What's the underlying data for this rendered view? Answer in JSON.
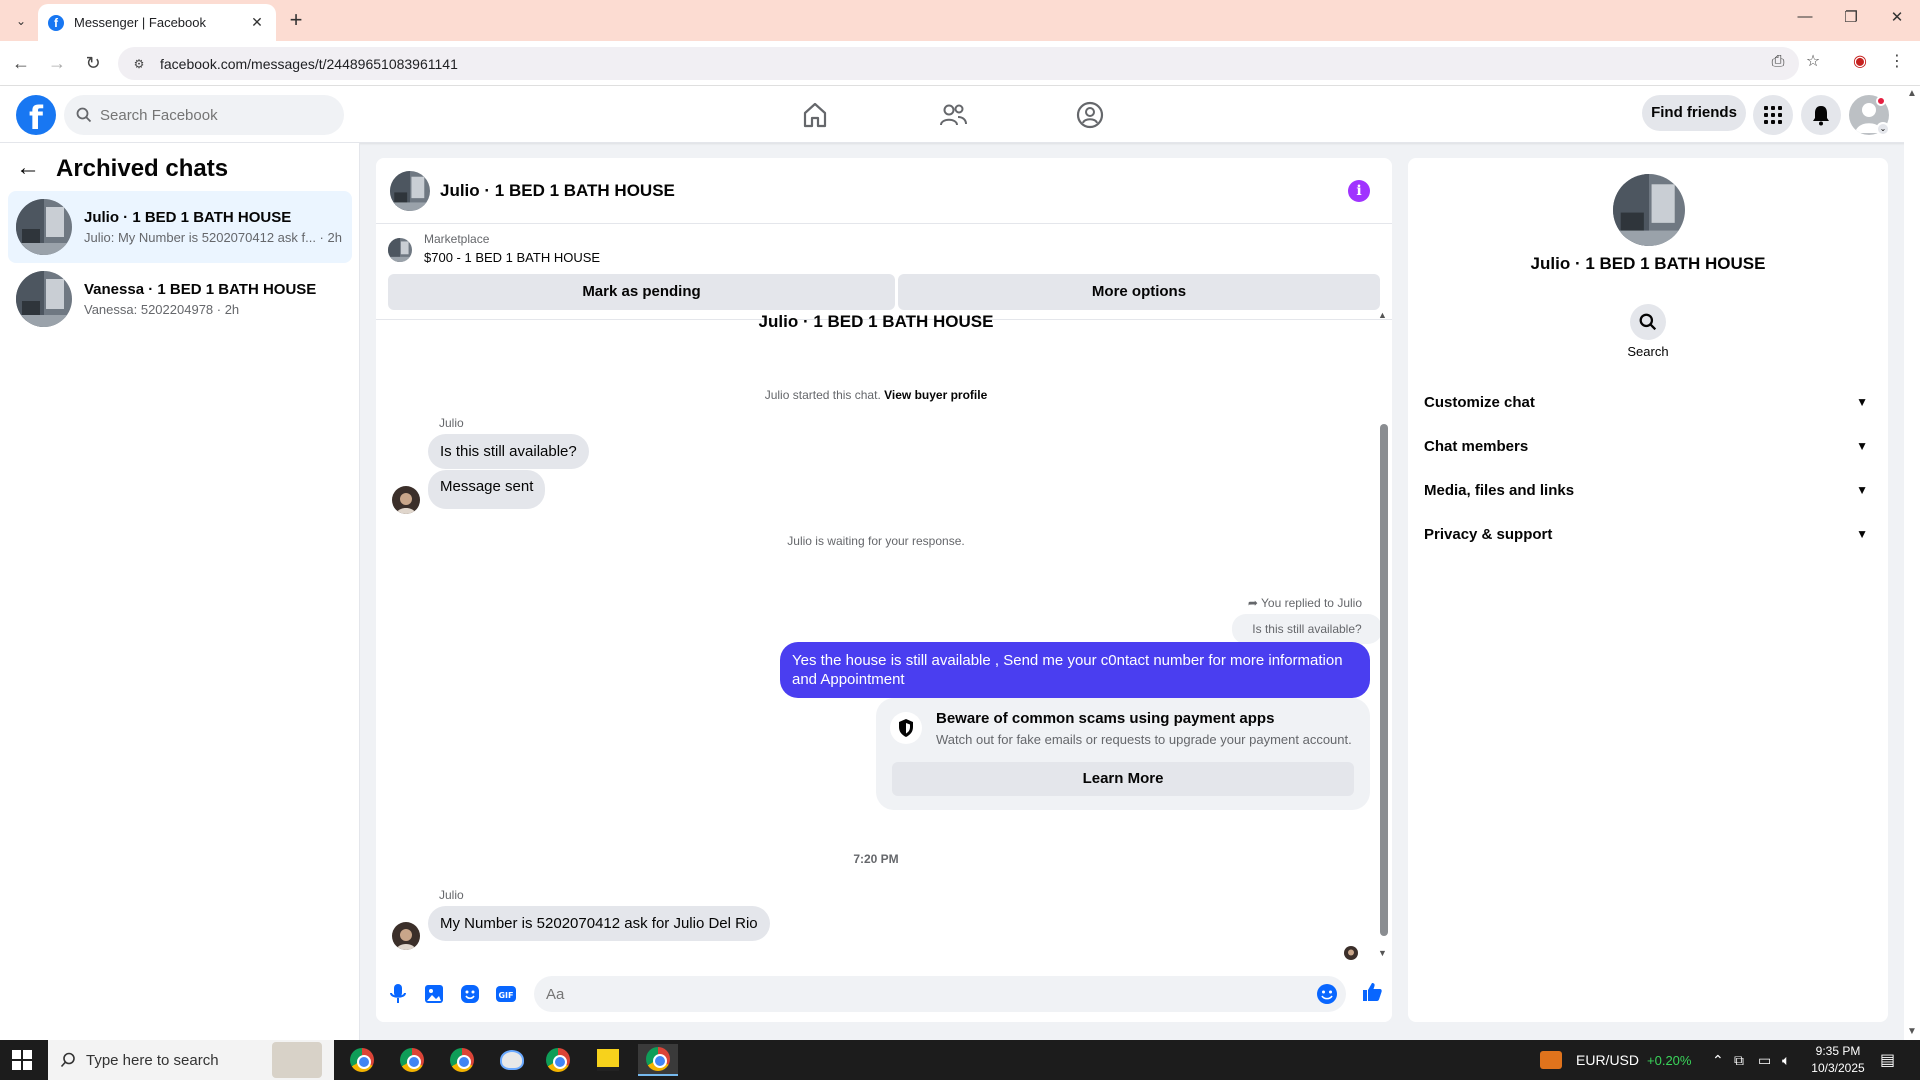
{
  "browser": {
    "tab_title": "Messenger | Facebook",
    "url": "facebook.com/messages/t/24489651083961141"
  },
  "fbnav": {
    "search_placeholder": "Search Facebook",
    "find_friends": "Find friends"
  },
  "sidebar": {
    "title": "Archived chats",
    "chats": [
      {
        "name": "Julio · 1 BED 1 BATH HOUSE",
        "preview": "Julio: My Number is 5202070412 ask f... · 2h"
      },
      {
        "name": "Vanessa · 1 BED 1 BATH HOUSE",
        "preview": "Vanessa: 5202204978 · 2h"
      }
    ]
  },
  "conversation": {
    "title": "Julio · 1 BED 1 BATH HOUSE",
    "marketplace_label": "Marketplace",
    "listing": "$700 - 1 BED 1 BATH HOUSE",
    "mark_pending": "Mark as pending",
    "more_options": "More options",
    "cut_title": "Julio · 1 BED 1 BATH HOUSE",
    "started_text": "Julio started this chat.",
    "view_buyer": "View buyer profile",
    "sender1": "Julio",
    "msg1": "Is this still available?",
    "msg2": "Message sent",
    "waiting": "Julio is waiting for your response.",
    "replied_to": "You replied to Julio",
    "quoted": "Is this still available?",
    "reply": "Yes the house is still available , Send me your c0ntact number for more information and Appointment",
    "scam_title": "Beware of common scams using payment apps",
    "scam_sub": "Watch out for fake emails or requests to upgrade your payment account.",
    "learn_more": "Learn More",
    "time": "7:20 PM",
    "sender2": "Julio",
    "msg3": "My Number is 5202070412 ask for Julio Del Rio",
    "composer_placeholder": "Aa"
  },
  "details": {
    "name": "Julio · 1 BED 1 BATH HOUSE",
    "search_label": "Search",
    "sections": [
      "Customize chat",
      "Chat members",
      "Media, files and links",
      "Privacy & support"
    ]
  },
  "taskbar": {
    "search_placeholder": "Type here to search",
    "ticker_name": "EUR/USD",
    "ticker_change": "+0.20%",
    "time": "9:35 PM",
    "date": "10/3/2025"
  },
  "colors": {
    "brand": "#1877f2",
    "outgoing_bubble": "#4a3ef0",
    "info_icon": "#a033ff",
    "ticker_up": "#3ad45a"
  }
}
